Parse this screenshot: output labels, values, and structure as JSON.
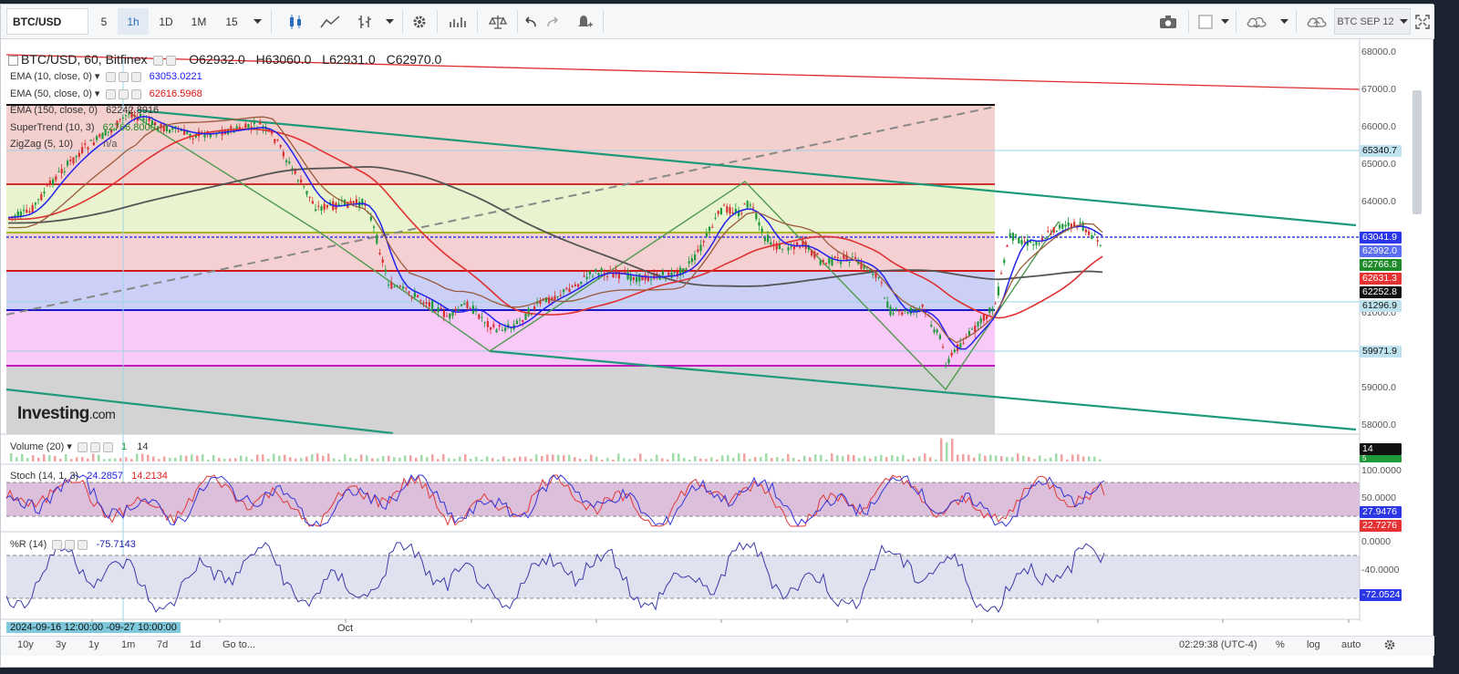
{
  "toolbar": {
    "symbol": "BTC/USD",
    "intervals": [
      "5",
      "1h",
      "1D",
      "1M",
      "15"
    ],
    "active_interval": "1h",
    "contract": "BTC SEP 12"
  },
  "legend": {
    "title": "BTC/USD, 60, Bitfinex",
    "open": "O62932.0",
    "high": "H63060.0",
    "low": "L62931.0",
    "close": "C62970.0",
    "indicators": [
      {
        "name": "EMA (10, close, 0)",
        "value": "63053.0221",
        "color": "#1a1aff"
      },
      {
        "name": "EMA (50, close, 0)",
        "value": "62616.5968",
        "color": "#dd1111"
      },
      {
        "name": "EMA (150, close, 0)",
        "value": "62242.8916",
        "color": "#333333"
      },
      {
        "name": "SuperTrend (10, 3)",
        "value": "62766.8000",
        "color": "#1e8a1e"
      },
      {
        "name": "ZigZag (5, 10)",
        "value": "n/a",
        "color": "#555555"
      }
    ]
  },
  "price_axis": {
    "ticks": [
      "68000.0",
      "67000.0",
      "66000.0",
      "65000.0",
      "64000.0",
      "61000.0",
      "59000.0",
      "58000.0"
    ],
    "badges": [
      {
        "text": "65340.7",
        "bg": "#bfe3ee",
        "fg": "#111111"
      },
      {
        "text": "63041.9",
        "bg": "#2b36e6",
        "fg": "#ffffff"
      },
      {
        "text": "62992.0",
        "bg": "#5b6ef0",
        "fg": "#ffffff"
      },
      {
        "text": "62766.8",
        "bg": "#1f8a2a",
        "fg": "#ffffff"
      },
      {
        "text": "62631.3",
        "bg": "#e53333",
        "fg": "#ffffff"
      },
      {
        "text": "62252.8",
        "bg": "#111111",
        "fg": "#ffffff"
      },
      {
        "text": "61296.9",
        "bg": "#bfe3ee",
        "fg": "#111111"
      },
      {
        "text": "59971.9",
        "bg": "#bfe3ee",
        "fg": "#111111"
      }
    ]
  },
  "logo": {
    "brand": "Investing",
    "suffix": ".com"
  },
  "volume": {
    "label": "Volume (20)",
    "value1": "1",
    "value2": "14",
    "badge1": "14",
    "badge2": "5"
  },
  "stoch": {
    "label": "Stoch (14, 1, 3)",
    "k": "24.2857",
    "d": "14.2134",
    "ticks": [
      "100.0000",
      "50.0000"
    ],
    "badge_k": "27.9476",
    "badge_d": "22.7276"
  },
  "williams": {
    "label": "%R (14)",
    "value": "-75.7143",
    "ticks": [
      "0.0000",
      "-40.0000"
    ],
    "badge": "-72.0524"
  },
  "time_axis": {
    "range": "2024-09-16 12:00:00 -09-27 10:00:00",
    "month_label": "Oct"
  },
  "bottombar": {
    "ranges": [
      "10y",
      "3y",
      "1y",
      "1m",
      "7d",
      "1d"
    ],
    "goto": "Go to...",
    "clock": "02:29:38 (UTC-4)",
    "pct": "%",
    "log": "log",
    "auto": "auto"
  },
  "colors": {
    "ema10": "#2222ee",
    "ema50": "#e03030",
    "ema150": "#555555",
    "supertrend": "#2f9a2f",
    "channel": "#1e9a7a",
    "up": "#1f9a3a",
    "down": "#d93030"
  }
}
